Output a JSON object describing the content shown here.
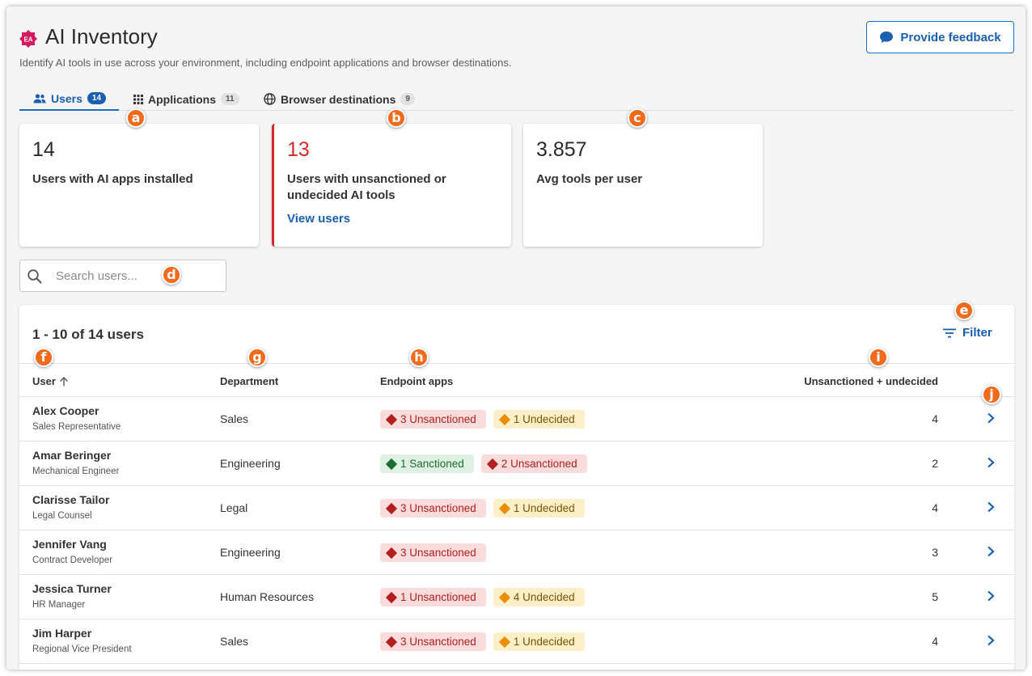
{
  "header": {
    "logo_text": "EA",
    "title": "AI Inventory",
    "subtitle": "Identify AI tools in use across your environment, including endpoint applications and browser destinations.",
    "feedback_label": "Provide feedback"
  },
  "tabs": [
    {
      "label": "Users",
      "count": "14",
      "icon": "users-icon",
      "active": true
    },
    {
      "label": "Applications",
      "count": "11",
      "icon": "grid-icon",
      "active": false
    },
    {
      "label": "Browser destinations",
      "count": "9",
      "icon": "globe-icon",
      "active": false
    }
  ],
  "cards": [
    {
      "value": "14",
      "label": "Users with AI apps installed"
    },
    {
      "value": "13",
      "label": "Users with unsanctioned or undecided AI tools",
      "link": "View users"
    },
    {
      "value": "3.857",
      "label": "Avg tools per user"
    }
  ],
  "search": {
    "placeholder": "Search users..."
  },
  "table": {
    "result_count": "1 - 10 of 14 users",
    "filter_label": "Filter",
    "columns": {
      "user": "User",
      "department": "Department",
      "endpoint_apps": "Endpoint apps",
      "unsanctioned_undecided": "Unsanctioned + undecided"
    },
    "rows": [
      {
        "name": "Alex Cooper",
        "title": "Sales Representative",
        "department": "Sales",
        "apps": [
          {
            "label": "3 Unsanctioned",
            "kind": "unsanctioned"
          },
          {
            "label": "1 Undecided",
            "kind": "undecided"
          }
        ],
        "total": "4"
      },
      {
        "name": "Amar Beringer",
        "title": "Mechanical Engineer",
        "department": "Engineering",
        "apps": [
          {
            "label": "1 Sanctioned",
            "kind": "sanctioned"
          },
          {
            "label": "2 Unsanctioned",
            "kind": "unsanctioned"
          }
        ],
        "total": "2"
      },
      {
        "name": "Clarisse Tailor",
        "title": "Legal Counsel",
        "department": "Legal",
        "apps": [
          {
            "label": "3 Unsanctioned",
            "kind": "unsanctioned"
          },
          {
            "label": "1 Undecided",
            "kind": "undecided"
          }
        ],
        "total": "4"
      },
      {
        "name": "Jennifer Vang",
        "title": "Contract Developer",
        "department": "Engineering",
        "apps": [
          {
            "label": "3 Unsanctioned",
            "kind": "unsanctioned"
          }
        ],
        "total": "3"
      },
      {
        "name": "Jessica Turner",
        "title": "HR Manager",
        "department": "Human Resources",
        "apps": [
          {
            "label": "1 Unsanctioned",
            "kind": "unsanctioned"
          },
          {
            "label": "4 Undecided",
            "kind": "undecided"
          }
        ],
        "total": "5"
      },
      {
        "name": "Jim Harper",
        "title": "Regional Vice President",
        "department": "Sales",
        "apps": [
          {
            "label": "3 Unsanctioned",
            "kind": "unsanctioned"
          },
          {
            "label": "1 Undecided",
            "kind": "undecided"
          }
        ],
        "total": "4"
      }
    ]
  },
  "markers": [
    "a",
    "b",
    "c",
    "d",
    "e",
    "f",
    "g",
    "h",
    "i",
    "j"
  ],
  "colors": {
    "accent": "#1a5fb0",
    "alert": "#d42a2a",
    "marker": "#f26b1d",
    "logo": "#d6195f"
  }
}
